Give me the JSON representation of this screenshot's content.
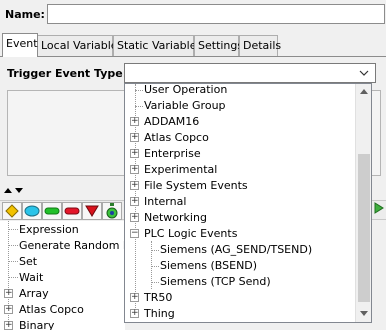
{
  "name_field": {
    "label": "Name:",
    "value": ""
  },
  "tabs": [
    "Event",
    "Local Variables",
    "Static Variables",
    "Settings",
    "Details"
  ],
  "trigger": {
    "label": "Trigger Event Type:",
    "value": ""
  },
  "palette_tree": [
    {
      "label": "Expression",
      "expandable": false
    },
    {
      "label": "Generate Random Nu",
      "expandable": false
    },
    {
      "label": "Set",
      "expandable": false
    },
    {
      "label": "Wait",
      "expandable": false
    },
    {
      "label": "Array",
      "expandable": true
    },
    {
      "label": "Atlas Copco",
      "expandable": true
    },
    {
      "label": "Binary",
      "expandable": true
    }
  ],
  "dropdown_items": [
    {
      "label": "User Operation",
      "level": 0,
      "expander": "none"
    },
    {
      "label": "Variable Group",
      "level": 0,
      "expander": "none"
    },
    {
      "label": "ADDAM16",
      "level": 0,
      "expander": "+"
    },
    {
      "label": "Atlas Copco",
      "level": 0,
      "expander": "+"
    },
    {
      "label": "Enterprise",
      "level": 0,
      "expander": "+"
    },
    {
      "label": "Experimental",
      "level": 0,
      "expander": "+"
    },
    {
      "label": "File System Events",
      "level": 0,
      "expander": "+"
    },
    {
      "label": "Internal",
      "level": 0,
      "expander": "+"
    },
    {
      "label": "Networking",
      "level": 0,
      "expander": "+"
    },
    {
      "label": "PLC Logic Events",
      "level": 0,
      "expander": "-"
    },
    {
      "label": "Siemens (AG_SEND/TSEND)",
      "level": 1,
      "expander": "none"
    },
    {
      "label": "Siemens (BSEND)",
      "level": 1,
      "expander": "none"
    },
    {
      "label": "Siemens (TCP Send)",
      "level": 1,
      "expander": "none"
    },
    {
      "label": "TR50",
      "level": 0,
      "expander": "+"
    },
    {
      "label": "Thing",
      "level": 0,
      "expander": "+"
    }
  ],
  "toolbar_icons": [
    "diamond-icon",
    "ellipse-icon",
    "green-rounded-rect-icon",
    "red-rounded-rect-icon",
    "red-triangle-icon",
    "stopwatch-icon"
  ],
  "colors": {
    "tab_active_bg": "#ffffff",
    "popup_border": "#828790"
  }
}
